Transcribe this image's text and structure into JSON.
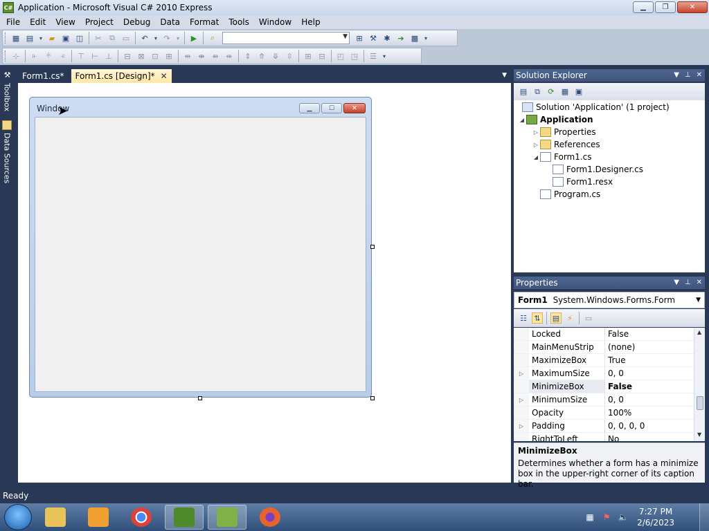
{
  "window": {
    "title": "Application - Microsoft Visual C# 2010 Express",
    "icon_label": "C#",
    "minimize": "▁",
    "maximize": "❐",
    "close": "✕"
  },
  "menu": [
    "File",
    "Edit",
    "View",
    "Project",
    "Debug",
    "Data",
    "Format",
    "Tools",
    "Window",
    "Help"
  ],
  "sidetabs": {
    "toolbox": "Toolbox",
    "data_sources": "Data Sources"
  },
  "doc_tabs": [
    {
      "label": "Form1.cs*",
      "active": false
    },
    {
      "label": "Form1.cs [Design]*",
      "active": true
    }
  ],
  "doc_tab_close": "✕",
  "form": {
    "caption": "Window",
    "minimize": "▁",
    "maximize": "☐",
    "close": "✕"
  },
  "solution_explorer": {
    "title": "Solution Explorer",
    "tree": [
      {
        "label": "Solution 'Application' (1 project)",
        "level": 0,
        "twisty": "",
        "icon": "sol"
      },
      {
        "label": "Application",
        "level": 0,
        "twisty": "◢",
        "icon": "csproj",
        "bold": true
      },
      {
        "label": "Properties",
        "level": 1,
        "twisty": "▷",
        "icon": "folder"
      },
      {
        "label": "References",
        "level": 1,
        "twisty": "▷",
        "icon": "folder"
      },
      {
        "label": "Form1.cs",
        "level": 1,
        "twisty": "◢",
        "icon": "cs"
      },
      {
        "label": "Form1.Designer.cs",
        "level": 2,
        "twisty": "",
        "icon": "cs"
      },
      {
        "label": "Form1.resx",
        "level": 2,
        "twisty": "",
        "icon": "cs"
      },
      {
        "label": "Program.cs",
        "level": 1,
        "twisty": "",
        "icon": "cs"
      }
    ]
  },
  "properties": {
    "title": "Properties",
    "object_name": "Form1",
    "object_type": "System.Windows.Forms.Form",
    "rows": [
      {
        "name": "Locked",
        "value": "False",
        "expand": ""
      },
      {
        "name": "MainMenuStrip",
        "value": "(none)",
        "expand": ""
      },
      {
        "name": "MaximizeBox",
        "value": "True",
        "expand": ""
      },
      {
        "name": "MaximumSize",
        "value": "0, 0",
        "expand": "▷"
      },
      {
        "name": "MinimizeBox",
        "value": "False",
        "expand": "",
        "selected": true
      },
      {
        "name": "MinimumSize",
        "value": "0, 0",
        "expand": "▷"
      },
      {
        "name": "Opacity",
        "value": "100%",
        "expand": ""
      },
      {
        "name": "Padding",
        "value": "0, 0, 0, 0",
        "expand": "▷"
      },
      {
        "name": "RightToLeft",
        "value": "No",
        "expand": ""
      }
    ],
    "desc_title": "MinimizeBox",
    "desc_text": "Determines whether a form has a minimize box in the upper-right corner of its caption bar."
  },
  "status": "Ready",
  "taskbar": {
    "time": "7:27 PM",
    "date": "2/6/2023",
    "tasks": [
      {
        "name": "explorer",
        "color": "#e8c35a"
      },
      {
        "name": "media-player",
        "color": "#f0a030"
      },
      {
        "name": "chrome",
        "color": "#d9433a"
      },
      {
        "name": "visual-csharp",
        "color": "#4f8a2a",
        "active": true
      },
      {
        "name": "notepad-plus",
        "color": "#7fb04a",
        "active": true
      },
      {
        "name": "firefox",
        "color": "#e8632b"
      }
    ]
  }
}
